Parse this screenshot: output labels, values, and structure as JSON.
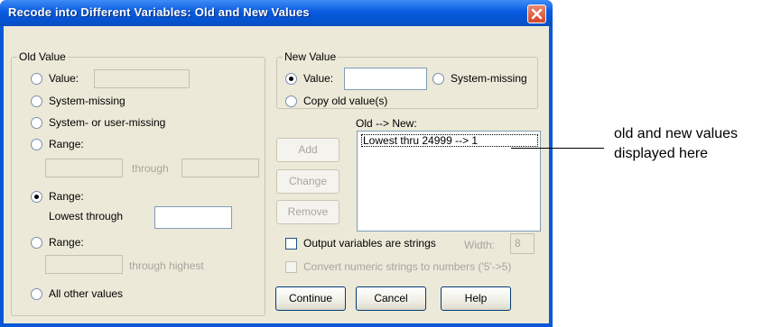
{
  "window": {
    "title": "Recode into Different Variables: Old and New Values"
  },
  "old_value": {
    "legend": "Old Value",
    "value_label": "Value:",
    "system_missing_label": "System-missing",
    "sys_user_missing_label": "System- or user-missing",
    "range1_label": "Range:",
    "through_label": "through",
    "range_lowest_label": "Range:",
    "lowest_through_label": "Lowest through",
    "range_highest_label": "Range:",
    "through_highest_label": "through highest",
    "all_other_label": "All other values",
    "selected": "Range: Lowest through"
  },
  "new_value": {
    "legend": "New Value",
    "value_label": "Value:",
    "system_missing_label": "System-missing",
    "copy_old_label": "Copy old value(s)",
    "selected": "Value:"
  },
  "mapping": {
    "header": "Old --> New:",
    "items": [
      "Lowest thru 24999 --> 1"
    ]
  },
  "actions": {
    "add": "Add",
    "change": "Change",
    "remove": "Remove"
  },
  "options": {
    "output_strings_label": "Output variables are strings",
    "width_label": "Width:",
    "width_value": "8",
    "convert_label": "Convert numeric strings to numbers ('5'->5)"
  },
  "footer": {
    "continue": "Continue",
    "cancel": "Cancel",
    "help": "Help"
  },
  "annotation": {
    "line1": "old and new values",
    "line2": "displayed here"
  },
  "colors": {
    "titlebar": "#0a5ae0",
    "dialog_bg": "#ece9d8",
    "close_button": "#d2452b"
  },
  "icons": {
    "close": "close-icon"
  }
}
